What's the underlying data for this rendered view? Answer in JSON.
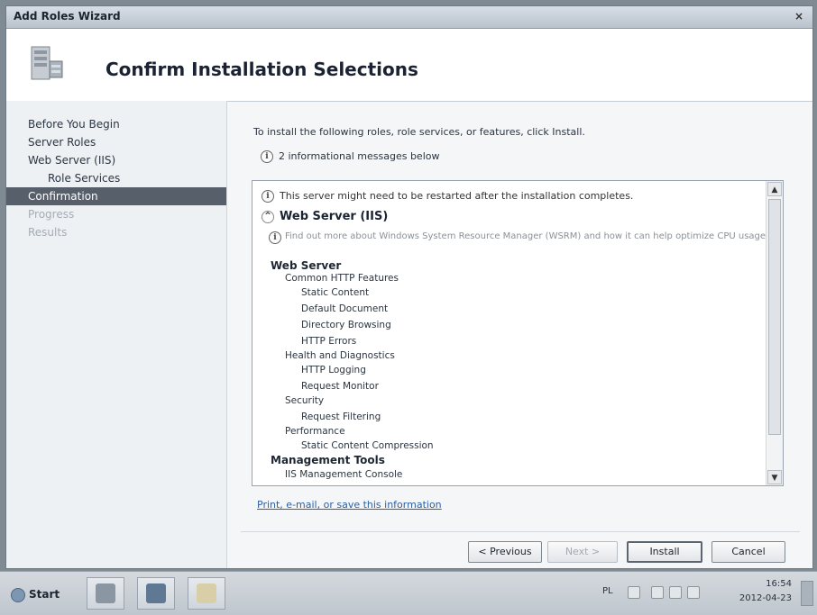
{
  "window": {
    "title": "Add Roles Wizard",
    "close_glyph": "×"
  },
  "header": {
    "title": "Confirm Installation Selections",
    "icon": "server-roles-icon"
  },
  "nav": {
    "items": [
      {
        "label": "Before You Begin",
        "state": "normal"
      },
      {
        "label": "Server Roles",
        "state": "normal"
      },
      {
        "label": "Web Server (IIS)",
        "state": "normal"
      },
      {
        "label": "Role Services",
        "state": "normal",
        "indent": true
      },
      {
        "label": "Confirmation",
        "state": "active"
      },
      {
        "label": "Progress",
        "state": "disabled"
      },
      {
        "label": "Results",
        "state": "disabled"
      }
    ]
  },
  "content": {
    "intro": "To install the following roles, role services, or features, click Install.",
    "info_count": "2 informational messages below",
    "restart_msg": "This server might need to be restarted after the installation completes.",
    "section_title": "Web Server (IIS)",
    "wsrm_msg": "Find out more about Windows System Resource Manager (WSRM) and how it can help optimize CPU usage",
    "tree": [
      {
        "label": "Web Server",
        "level": 0
      },
      {
        "label": "Common HTTP Features",
        "level": 1
      },
      {
        "label": "Static Content",
        "level": 2
      },
      {
        "label": "Default Document",
        "level": 2
      },
      {
        "label": "Directory Browsing",
        "level": 2
      },
      {
        "label": "HTTP Errors",
        "level": 2
      },
      {
        "label": "Health and Diagnostics",
        "level": 1
      },
      {
        "label": "HTTP Logging",
        "level": 2
      },
      {
        "label": "Request Monitor",
        "level": 2
      },
      {
        "label": "Security",
        "level": 1
      },
      {
        "label": "Request Filtering",
        "level": 2
      },
      {
        "label": "Performance",
        "level": 1
      },
      {
        "label": "Static Content Compression",
        "level": 2
      },
      {
        "label": "Management Tools",
        "level": 0
      },
      {
        "label": "IIS Management Console",
        "level": 1
      }
    ],
    "print_link": "Print, e-mail, or save this information"
  },
  "buttons": {
    "previous": "< Previous",
    "next": "Next >",
    "install": "Install",
    "cancel": "Cancel"
  },
  "taskbar": {
    "start_label": "Start",
    "lang": "PL",
    "time": "16:54",
    "date": "2012-04-23"
  }
}
